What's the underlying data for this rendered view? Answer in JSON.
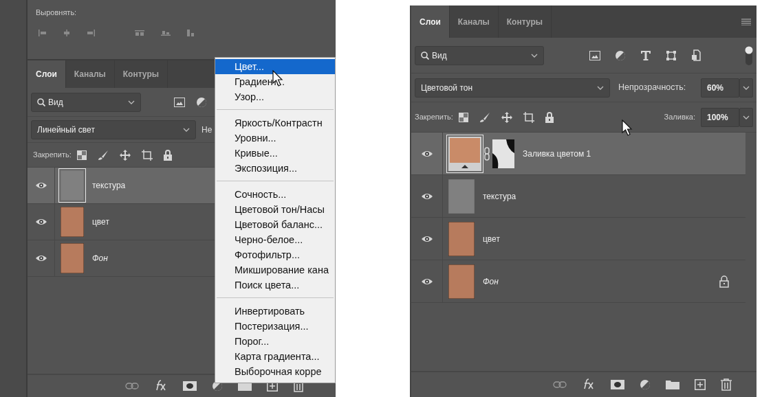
{
  "left_panel": {
    "align_label": "Выровнять:",
    "tabs": [
      {
        "label": "Слои",
        "selected": true
      },
      {
        "label": "Каналы",
        "selected": false
      },
      {
        "label": "Контуры",
        "selected": false
      }
    ],
    "filter": {
      "value": "Вид"
    },
    "blend_mode": "Линейный свет",
    "opacity_label": "Не",
    "lock_label": "Закрепить:",
    "layers": [
      {
        "name": "текстура",
        "kind": "texture",
        "visible": true,
        "selected": true
      },
      {
        "name": "цвет",
        "kind": "photo",
        "visible": true,
        "selected": false
      },
      {
        "name": "Фон",
        "kind": "background",
        "visible": true,
        "selected": false
      }
    ]
  },
  "context_menu": {
    "groups": [
      {
        "items": [
          {
            "label": "Цвет...",
            "selected": true
          },
          {
            "label": "Градиент...",
            "selected": false
          },
          {
            "label": "Узор...",
            "selected": false
          }
        ]
      },
      {
        "items": [
          {
            "label": "Яркость/Контрастн",
            "selected": false
          },
          {
            "label": "Уровни...",
            "selected": false
          },
          {
            "label": "Кривые...",
            "selected": false
          },
          {
            "label": "Экспозиция...",
            "selected": false
          }
        ]
      },
      {
        "items": [
          {
            "label": "Сочность...",
            "selected": false
          },
          {
            "label": "Цветовой тон/Насы",
            "selected": false
          },
          {
            "label": "Цветовой баланс...",
            "selected": false
          },
          {
            "label": "Черно-белое...",
            "selected": false
          },
          {
            "label": "Фотофильтр...",
            "selected": false
          },
          {
            "label": "Микширование кана",
            "selected": false
          },
          {
            "label": "Поиск цвета...",
            "selected": false
          }
        ]
      },
      {
        "items": [
          {
            "label": "Инвертировать",
            "selected": false
          },
          {
            "label": "Постеризация...",
            "selected": false
          },
          {
            "label": "Порог...",
            "selected": false
          },
          {
            "label": "Карта градиента...",
            "selected": false
          },
          {
            "label": "Выборочная корре",
            "selected": false
          }
        ]
      }
    ]
  },
  "right_panel": {
    "tabs": [
      {
        "label": "Слои",
        "selected": true
      },
      {
        "label": "Каналы",
        "selected": false
      },
      {
        "label": "Контуры",
        "selected": false
      }
    ],
    "filter": {
      "value": "Вид"
    },
    "blend_mode": "Цветовой тон",
    "opacity_label": "Непрозрачность:",
    "opacity": "60%",
    "lock_label": "Закрепить:",
    "fill_label": "Заливка:",
    "fill": "100%",
    "layers": [
      {
        "name": "Заливка цветом 1",
        "kind": "fill",
        "visible": true,
        "selected": true,
        "locked": false
      },
      {
        "name": "текстура",
        "kind": "texture",
        "visible": true,
        "selected": false,
        "locked": false
      },
      {
        "name": "цвет",
        "kind": "photo",
        "visible": true,
        "selected": false,
        "locked": false
      },
      {
        "name": "Фон",
        "kind": "background",
        "visible": true,
        "selected": false,
        "locked": true
      }
    ]
  }
}
